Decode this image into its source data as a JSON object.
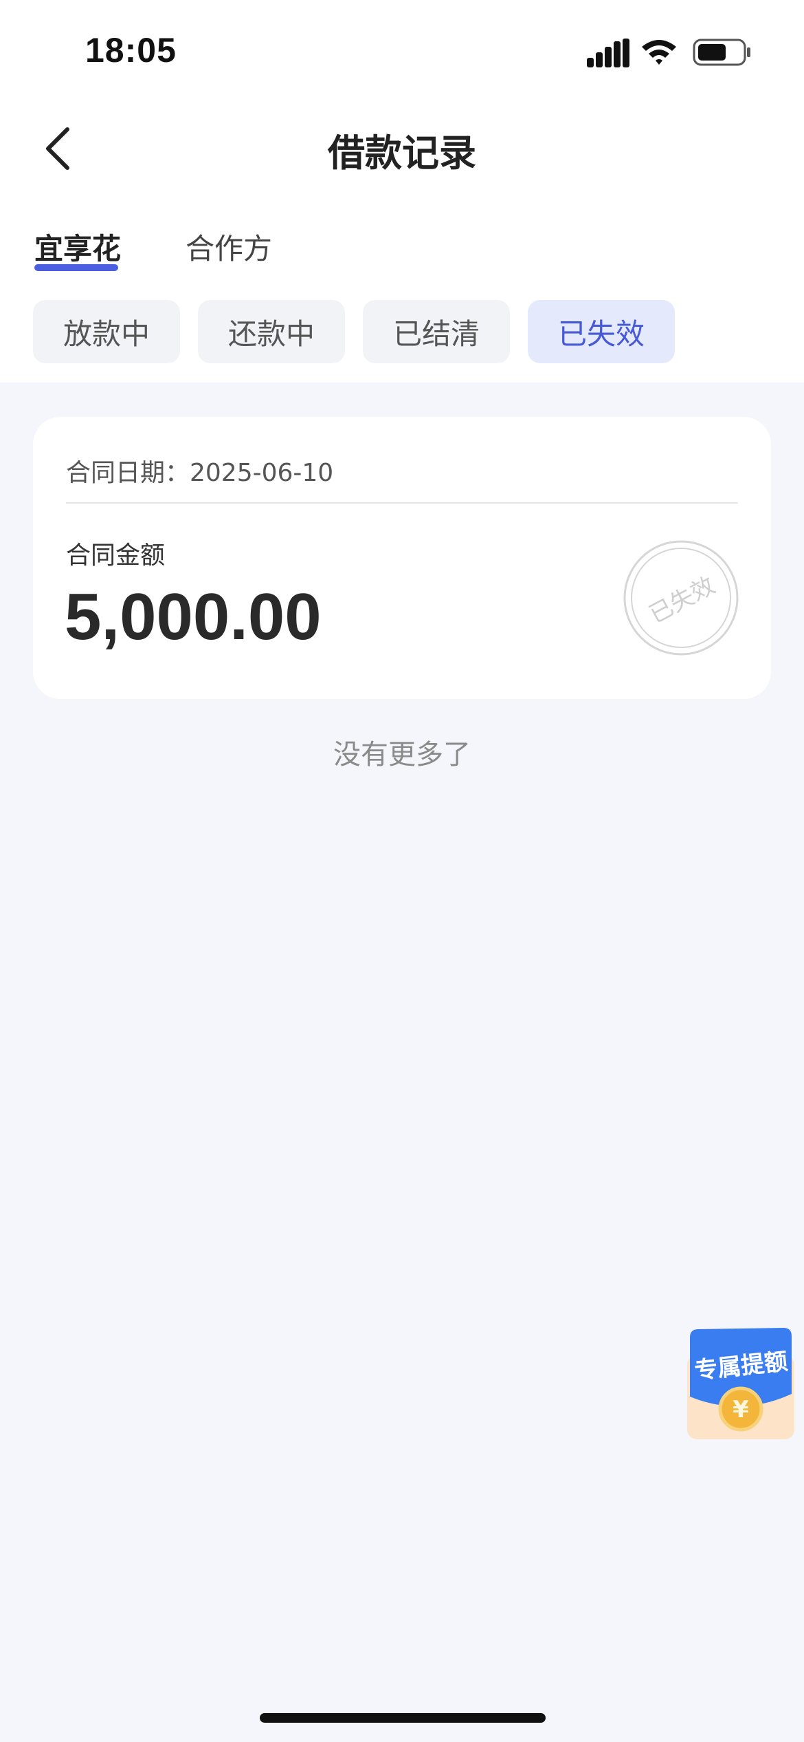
{
  "status_bar": {
    "time": "18:05",
    "signal_icon": "cellular-signal-icon",
    "wifi_icon": "wifi-icon",
    "battery_icon": "battery-icon"
  },
  "header": {
    "back_icon": "chevron-left-icon",
    "title": "借款记录"
  },
  "main_tabs": [
    {
      "label": "宜享花",
      "active": true
    },
    {
      "label": "合作方",
      "active": false
    }
  ],
  "status_filters": [
    {
      "label": "放款中",
      "active": false
    },
    {
      "label": "还款中",
      "active": false
    },
    {
      "label": "已结清",
      "active": false
    },
    {
      "label": "已失效",
      "active": true
    }
  ],
  "records": [
    {
      "date_label": "合同日期：2025-06-10",
      "amount_label": "合同金额",
      "amount": "5,000.00",
      "stamp": "已失效"
    }
  ],
  "list_end_text": "没有更多了",
  "promo": {
    "label": "专属提额",
    "icon": "yuan-coin-icon"
  },
  "colors": {
    "accent": "#4b5fe0",
    "background": "#f5f6fb",
    "chip_active_bg": "#e5e9fc"
  }
}
